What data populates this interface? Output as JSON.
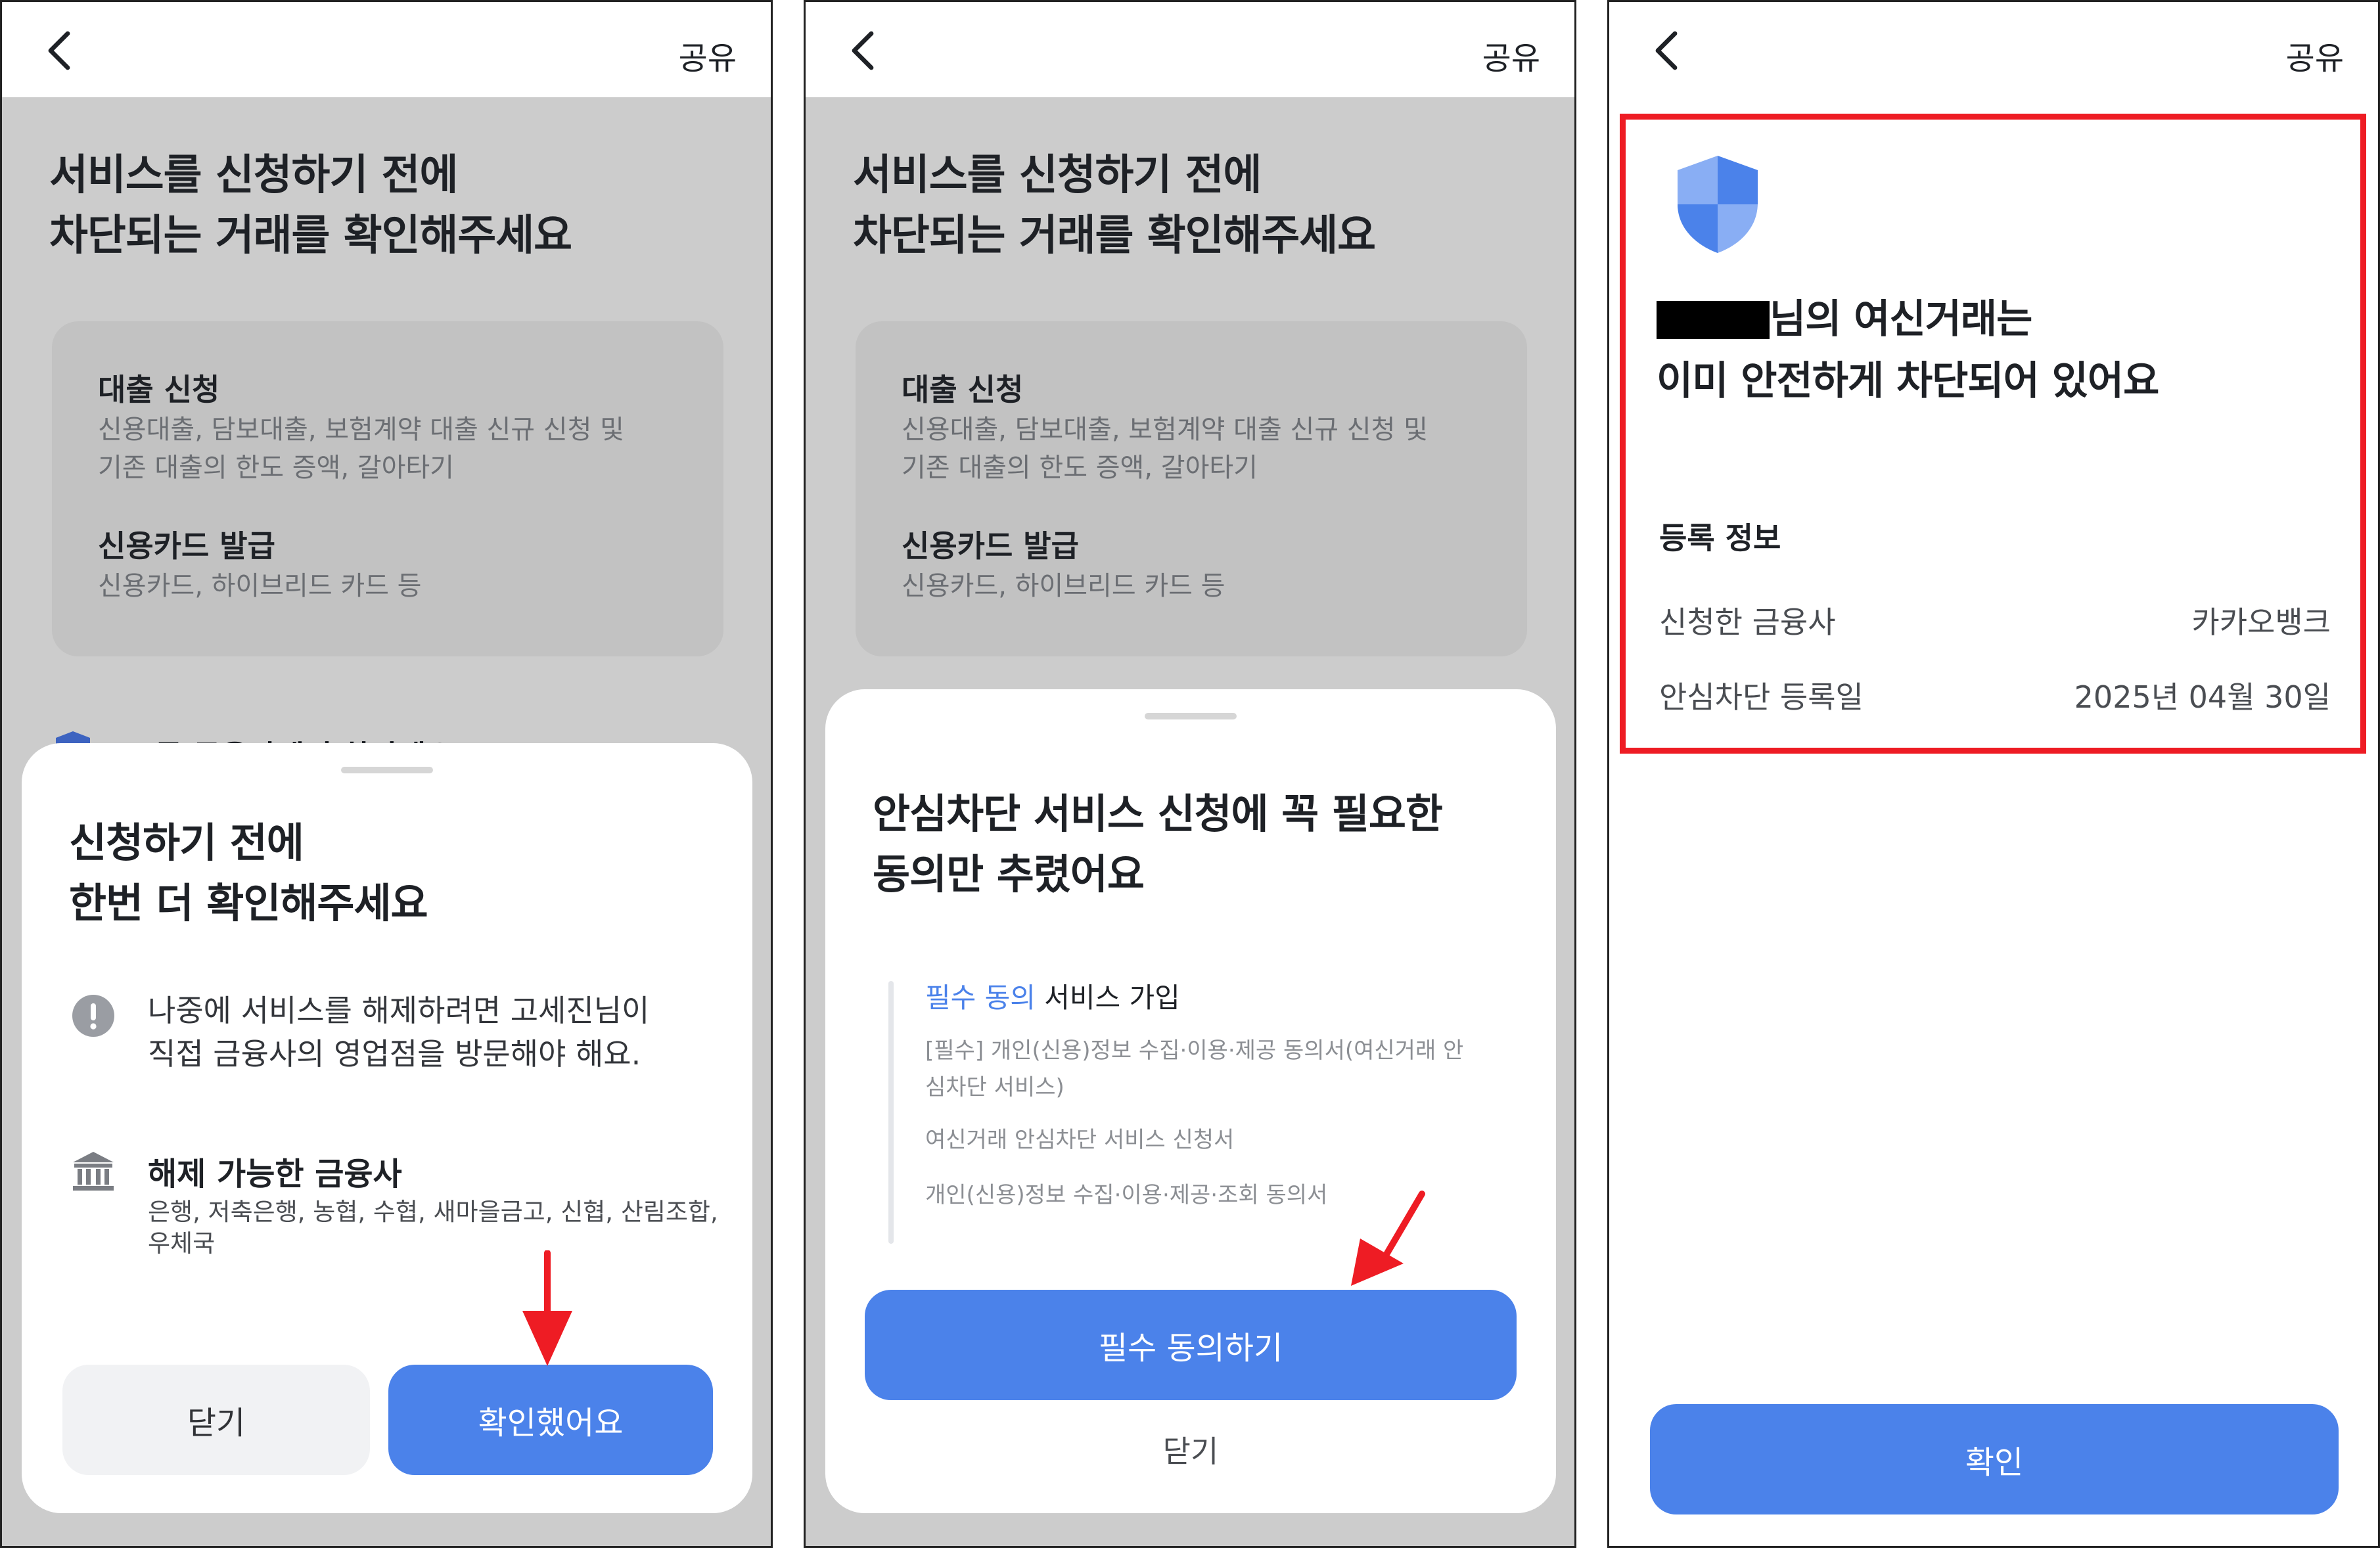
{
  "common": {
    "share_label": "공유",
    "headline_line1": "서비스를 신청하기 전에",
    "headline_line2": "차단되는 거래를 확인해주세요",
    "loan_title": "대출 신청",
    "loan_desc_line1": "신용대출, 담보대출, 보험계약 대출 신규 신청 및",
    "loan_desc_line2": "기존 대출의 한도 증액, 갈아타기",
    "card_title": "신용카드 발급",
    "card_desc": "신용카드, 하이브리드 카드 등",
    "peek_text": "모든 금융사에서 차단돼요"
  },
  "panel1": {
    "sheet_title_line1": "신청하기 전에",
    "sheet_title_line2": "한번 더 확인해주세요",
    "notice_line1": "나중에 서비스를 해제하려면 고세진님이",
    "notice_line2": "직접 금융사의 영업점을 방문해야 해요.",
    "bank_title": "해제 가능한 금융사",
    "bank_list_line1": "은행, 저축은행, 농협, 수협, 새마을금고, 신협, 산림조합,",
    "bank_list_line2": "우체국",
    "close_button": "닫기",
    "confirm_button": "확인했어요"
  },
  "panel2": {
    "sheet_title_line1": "안심차단 서비스 신청에 꼭 필요한",
    "sheet_title_line2": "동의만 추렸어요",
    "req_tag": "필수 동의",
    "req_heading": " 서비스 가입",
    "consent_1_line1": "[필수] 개인(신용)정보 수집·이용·제공 동의서(여신거래 안",
    "consent_1_line2": "심차단 서비스)",
    "consent_2": "여신거래 안심차단 서비스 신청서",
    "consent_3": "개인(신용)정보 수집·이용·제공·조회 동의서",
    "agree_button": "필수 동의하기",
    "close_link": "닫기"
  },
  "panel3": {
    "title_line1_suffix": "님의 여신거래는",
    "title_line2": "이미 안전하게 차단되어 있어요",
    "section_title": "등록 정보",
    "row1_label": "신청한 금융사",
    "row1_value": "카카오뱅크",
    "row2_label": "안심차단 등록일",
    "row2_value": "2025년 04월 30일",
    "confirm_button": "확인"
  },
  "colors": {
    "primary_blue": "#4b82ea",
    "annotation_red": "#ee1c24",
    "dim_overlay": "#cccccc"
  }
}
